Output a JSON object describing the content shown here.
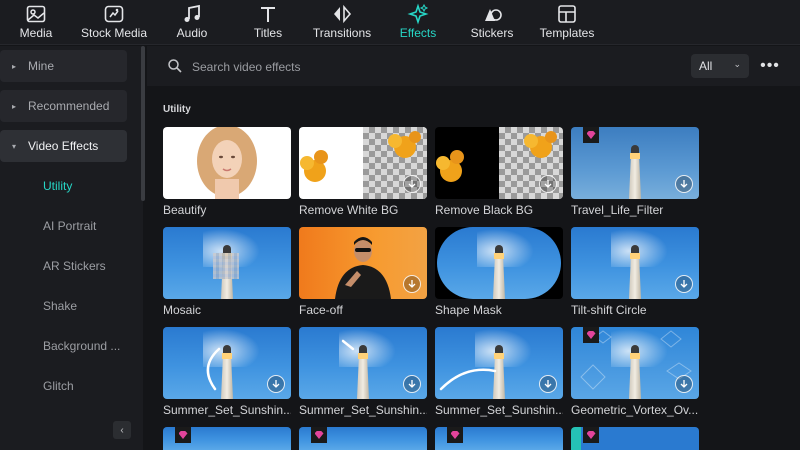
{
  "toolbar": {
    "items": [
      {
        "label": "Media",
        "icon": "media-icon"
      },
      {
        "label": "Stock Media",
        "icon": "stock-media-icon"
      },
      {
        "label": "Audio",
        "icon": "audio-note-icon"
      },
      {
        "label": "Titles",
        "icon": "titles-t-icon"
      },
      {
        "label": "Transitions",
        "icon": "transitions-icon"
      },
      {
        "label": "Effects",
        "icon": "effects-sparkle-icon",
        "active": true
      },
      {
        "label": "Stickers",
        "icon": "stickers-icon"
      },
      {
        "label": "Templates",
        "icon": "templates-icon"
      }
    ]
  },
  "sidebar": {
    "groups": [
      {
        "label": "Mine",
        "caret": "▸"
      },
      {
        "label": "Recommended",
        "caret": "▸"
      },
      {
        "label": "Video Effects",
        "caret": "▾"
      }
    ],
    "sub_items": [
      "Utility",
      "AI Portrait",
      "AR Stickers",
      "Shake",
      "Background ...",
      "Glitch"
    ],
    "active_sub": "Utility",
    "collapse_glyph": "‹"
  },
  "search": {
    "placeholder": "Search video effects",
    "filter_value": "All",
    "filter_chevron": "⌄",
    "more_glyph": "•••"
  },
  "section": {
    "title": "Utility"
  },
  "effects": [
    {
      "name": "Beautify"
    },
    {
      "name": "Remove White BG"
    },
    {
      "name": "Remove Black BG"
    },
    {
      "name": "Travel_Life_Filter"
    },
    {
      "name": "Mosaic"
    },
    {
      "name": "Face-off"
    },
    {
      "name": "Shape Mask"
    },
    {
      "name": "Tilt-shift Circle"
    },
    {
      "name": "Summer_Set_Sunshin..."
    },
    {
      "name": "Summer_Set_Sunshin..."
    },
    {
      "name": "Summer_Set_Sunshin..."
    },
    {
      "name": "Geometric_Vortex_Ov..."
    }
  ],
  "colors": {
    "accent": "#27d6c6",
    "premium": "#e2449b",
    "background": "#141518",
    "panel": "#1b1c20"
  }
}
